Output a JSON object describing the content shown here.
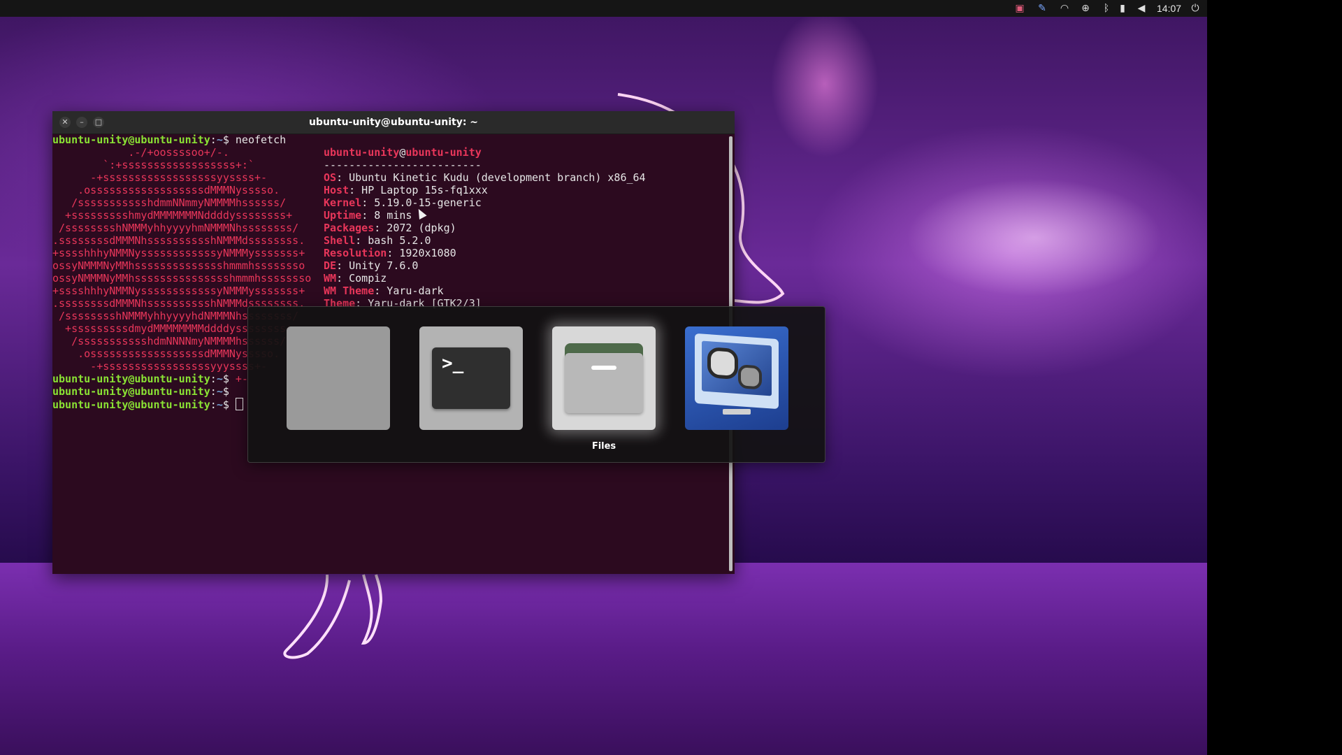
{
  "topbar": {
    "clock": "14:07",
    "indicators": [
      "screen-capture-icon",
      "pen-icon",
      "wifi-icon",
      "globe-icon",
      "bluetooth-icon",
      "battery-icon",
      "volume-icon",
      "power-icon"
    ]
  },
  "terminal": {
    "title": "ubuntu-unity@ubuntu-unity: ~",
    "prompt_user": "ubuntu-unity@ubuntu-unity",
    "prompt_path": "~",
    "command": "neofetch",
    "header_user": "ubuntu-unity",
    "header_at": "@",
    "header_host": "ubuntu-unity",
    "separator": "-------------------------",
    "info": [
      {
        "key": "OS",
        "value": ": Ubuntu Kinetic Kudu (development branch) x86_64"
      },
      {
        "key": "Host",
        "value": ": HP Laptop 15s-fq1xxx"
      },
      {
        "key": "Kernel",
        "value": ": 5.19.0-15-generic"
      },
      {
        "key": "Uptime",
        "value": ": 8 mins"
      },
      {
        "key": "Packages",
        "value": ": 2072 (dpkg)"
      },
      {
        "key": "Shell",
        "value": ": bash 5.2.0"
      },
      {
        "key": "Resolution",
        "value": ": 1920x1080"
      },
      {
        "key": "DE",
        "value": ": Unity 7.6.0"
      },
      {
        "key": "WM",
        "value": ": Compiz"
      },
      {
        "key": "WM Theme",
        "value": ": Yaru-dark"
      },
      {
        "key": "Theme",
        "value": ": Yaru-dark [GTK2/3]"
      }
    ],
    "art": [
      "            .-/+oossssoo+/-.",
      "        `:+ssssssssssssssssss+:`",
      "      -+ssssssssssssssssssyyssss+-",
      "    .ossssssssssssssssssdMMMNysssso.",
      "   /ssssssssssshdmmNNmmyNMMMMhssssss/",
      "  +ssssssssshmydMMMMMMMNddddyssssssss+",
      " /sssssssshNMMMyhhyyyyhmNMMMNhssssssss/",
      ".ssssssssdMMMNhsssssssssshNMMMdssssssss.",
      "+sssshhhyNMMNyssssssssssssyNMMMysssssss+",
      "ossyNMMMNyMMhsssssssssssssshmmmhssssssso",
      "ossyNMMMNyMMhssssssssssssssshmmmhssssssso",
      "+sssshhhyNMMNyssssssssssssyNMMMysssssss+",
      ".ssssssssdMMMNhsssssssssshNMMMdssssssss.",
      " /sssssssshNMMMyhhyyyyhdNMMMNhssssssss/",
      "  +sssssssssdmydMMMMMMMMddddyssssssss+",
      "   /ssssssssssshdmNNNNmyNMMMMhssssss/",
      "    .ossssssssssssssssssdMMMNysssso.",
      "      -+sssssssssssssssssyyyssss+-"
    ],
    "prompt_tail": "$ ",
    "art_tail": "+-"
  },
  "switcher": {
    "selected_label": "Files",
    "items": [
      "blank-window",
      "terminal",
      "files",
      "media-player"
    ]
  }
}
